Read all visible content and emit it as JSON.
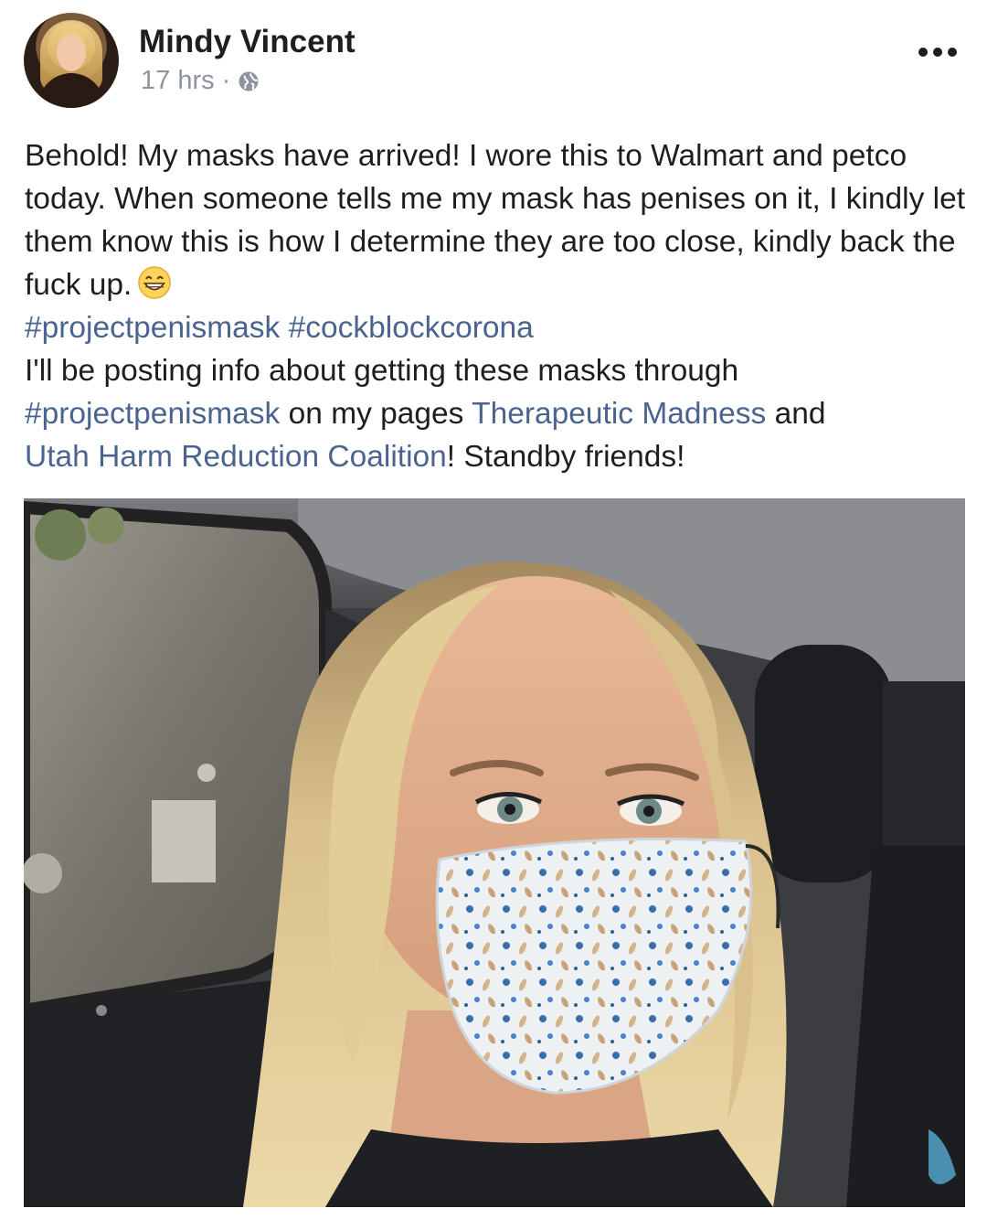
{
  "post": {
    "author": "Mindy Vincent",
    "time": "17 hrs",
    "separator": "·",
    "privacy_icon": "globe-icon",
    "more_icon": "more-options-icon",
    "text": {
      "line_a": "Behold! My masks have arrived! I wore this to Walmart and petco today. When someone tells me my mask has penises on it, I kindly let them know this is how I determine they are too close, kindly back the fuck up.",
      "emoji": "grinning-face-icon",
      "hashtag_1": "#projectpenismask",
      "hashtag_2": "#cockblockcorona",
      "line_b": "I'll be posting info about getting these masks through",
      "hashtag_3": "#projectpenismask",
      "line_c": " on my pages ",
      "page_1": "Therapeutic Madness",
      "line_d": " and ",
      "page_2": "Utah Harm Reduction Coalition",
      "line_e": "! Standby friends!"
    },
    "photo_icon": "selfie-photo"
  },
  "colors": {
    "text": "#1c1e21",
    "meta": "#8d949e",
    "link": "#4b648f"
  }
}
